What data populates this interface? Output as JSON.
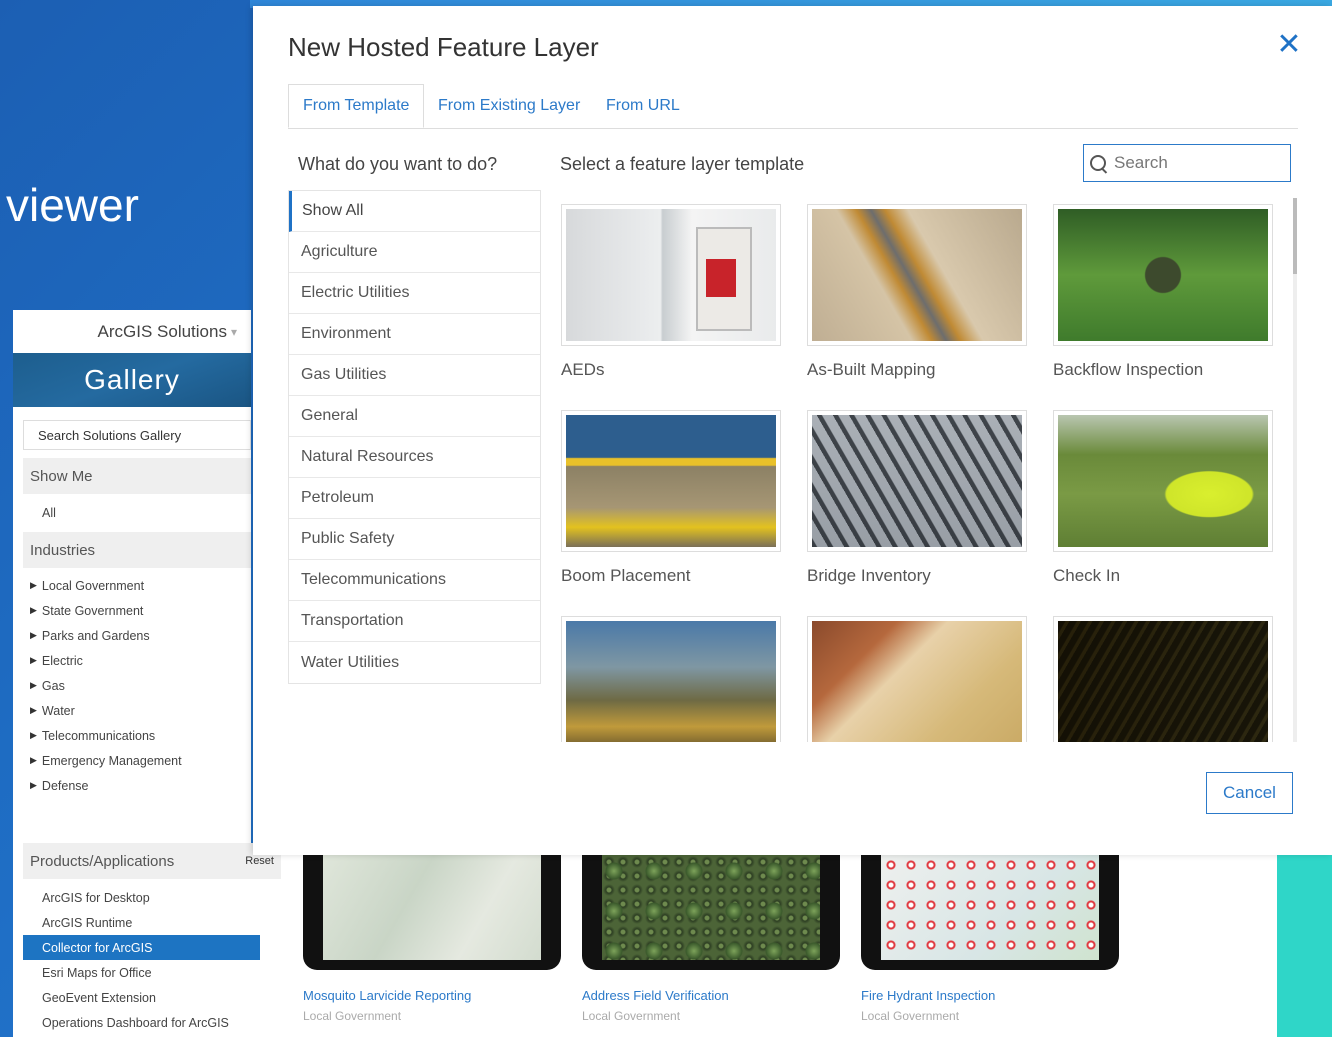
{
  "background": {
    "viewer_text": "viewer"
  },
  "solutions": {
    "header": "ArcGIS Solutions",
    "banner": "Gallery",
    "search_placeholder": "Search Solutions Gallery",
    "show_me_label": "Show Me",
    "show_me_items": [
      "All"
    ],
    "industries_label": "Industries",
    "industries": [
      "Local Government",
      "State Government",
      "Parks and Gardens",
      "Electric",
      "Gas",
      "Water",
      "Telecommunications",
      "Emergency Management",
      "Defense"
    ],
    "products_label": "Products/Applications",
    "reset_label": "Reset",
    "products": [
      "ArcGIS for Desktop",
      "ArcGIS Runtime",
      "Collector for ArcGIS",
      "Esri Maps for Office",
      "GeoEvent Extension",
      "Operations Dashboard for ArcGIS"
    ],
    "selected_product": "Collector for ArcGIS"
  },
  "cards": [
    {
      "title": "Mosquito Larvicide Reporting",
      "subtitle": "Local Government"
    },
    {
      "title": "Address Field Verification",
      "subtitle": "Local Government"
    },
    {
      "title": "Fire Hydrant Inspection",
      "subtitle": "Local Government"
    }
  ],
  "dialog": {
    "title": "New Hosted Feature Layer",
    "close_icon": "close-icon",
    "tabs": [
      "From Template",
      "From Existing Layer",
      "From URL"
    ],
    "active_tab": "From Template",
    "question": "What do you want to do?",
    "select_label": "Select a feature layer template",
    "search_placeholder": "Search",
    "categories": [
      "Show All",
      "Agriculture",
      "Electric Utilities",
      "Environment",
      "Gas Utilities",
      "General",
      "Natural Resources",
      "Petroleum",
      "Public Safety",
      "Telecommunications",
      "Transportation",
      "Water Utilities"
    ],
    "active_category": "Show All",
    "templates": [
      "AEDs",
      "As-Built Mapping",
      "Backflow Inspection",
      "Boom Placement",
      "Bridge Inventory",
      "Check In",
      "",
      "",
      ""
    ],
    "cancel_label": "Cancel"
  },
  "colors": {
    "accent": "#2c7ac9",
    "selected": "#1d74c2",
    "teal": "#2fd6c8"
  }
}
